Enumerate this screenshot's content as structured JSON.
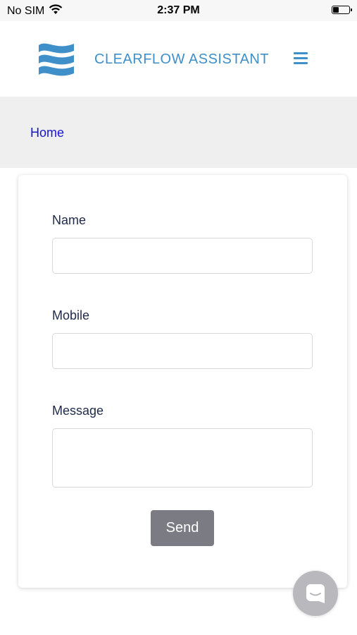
{
  "status_bar": {
    "carrier": "No SIM",
    "time": "2:37 PM",
    "wifi_icon": "wifi-icon",
    "battery_icon": "battery-icon"
  },
  "header": {
    "brand": "CLEARFLOW ASSISTANT",
    "logo_icon": "waves-logo-icon",
    "menu_icon": "hamburger-menu-icon",
    "accent_color": "#3f8fc9"
  },
  "breadcrumb": {
    "home_label": "Home",
    "link_color": "#1a13d6"
  },
  "form": {
    "name_label": "Name",
    "name_value": "",
    "mobile_label": "Mobile",
    "mobile_value": "",
    "message_label": "Message",
    "message_value": "",
    "send_label": "Send",
    "send_color": "#7b7b83"
  },
  "chat_widget": {
    "icon": "chat-bubble-icon"
  }
}
